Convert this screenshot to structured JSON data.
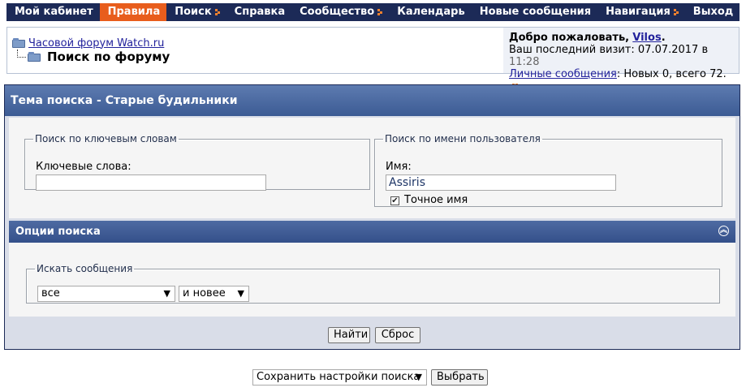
{
  "nav": {
    "items": [
      {
        "label": "Мой кабинет",
        "active": false,
        "menu": false
      },
      {
        "label": "Правила",
        "active": true,
        "menu": false
      },
      {
        "label": "Поиск",
        "active": false,
        "menu": true
      },
      {
        "label": "Справка",
        "active": false,
        "menu": false
      },
      {
        "label": "Сообщество",
        "active": false,
        "menu": true
      },
      {
        "label": "Календарь",
        "active": false,
        "menu": false
      },
      {
        "label": "Новые сообщения",
        "active": false,
        "menu": false
      },
      {
        "label": "Навигация",
        "active": false,
        "menu": true
      },
      {
        "label": "Выход",
        "active": false,
        "menu": false
      }
    ],
    "colors": {
      "bar": "#1c2a57",
      "active": "#e85d1c",
      "menu_icon": "#f0812e"
    }
  },
  "breadcrumb": {
    "forum_link": "Часовой форум Watch.ru",
    "page_title": "Поиск по форуму"
  },
  "welcome": {
    "greeting": "Добро пожаловать,",
    "username": "Vilos",
    "greeting_end": ".",
    "last_visit_label": "Ваш последний визит: 07.07.2017 в",
    "last_visit_time": "11:28",
    "pm_link": "Личные сообщения",
    "pm_status": ": Новых 0, всего 72."
  },
  "panel": {
    "title": "Тема поиска - Старые будильники",
    "keyword_fieldset": {
      "legend": "Поиск по ключевым словам",
      "label": "Ключевые слова:",
      "value": ""
    },
    "user_fieldset": {
      "legend": "Поиск по имени пользователя",
      "label": "Имя:",
      "value": "Assiris",
      "exact_checked": true,
      "exact_label": "Точное имя"
    },
    "options_title": "Опции поиска",
    "messages_fieldset": {
      "legend": "Искать сообщения",
      "period_value": "все",
      "direction_value": "и новее"
    },
    "find_button": "Найти",
    "reset_button": "Сброс"
  },
  "footer": {
    "save_select": "Сохранить настройки поиска",
    "choose_button": "Выбрать"
  }
}
